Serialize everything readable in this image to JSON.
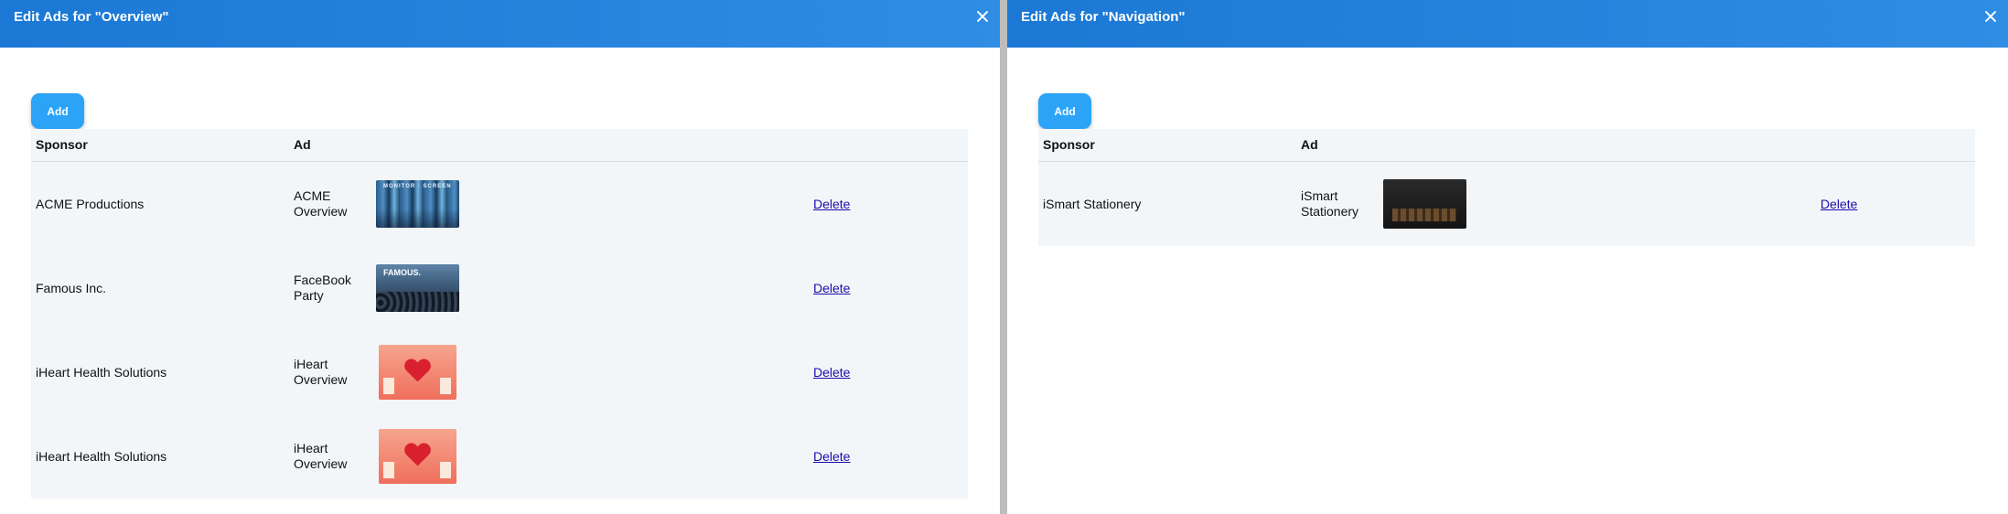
{
  "panels": [
    {
      "title": "Edit Ads for \"Overview\"",
      "add_label": "Add",
      "columns": {
        "sponsor": "Sponsor",
        "ad": "Ad"
      },
      "rows": [
        {
          "sponsor": "ACME Productions",
          "ad": "ACME Overview",
          "thumbnail": "acme-overview-thumbnail",
          "delete_label": "Delete"
        },
        {
          "sponsor": "Famous Inc.",
          "ad": "FaceBook Party",
          "thumbnail": "famous-facebook-party-thumbnail",
          "delete_label": "Delete"
        },
        {
          "sponsor": "iHeart Health Solutions",
          "ad": "iHeart Overview",
          "thumbnail": "iheart-overview-thumbnail",
          "delete_label": "Delete"
        },
        {
          "sponsor": "iHeart Health Solutions",
          "ad": "iHeart Overview",
          "thumbnail": "iheart-overview-thumbnail",
          "delete_label": "Delete"
        }
      ]
    },
    {
      "title": "Edit Ads for \"Navigation\"",
      "add_label": "Add",
      "columns": {
        "sponsor": "Sponsor",
        "ad": "Ad"
      },
      "rows": [
        {
          "sponsor": "iSmart Stationery",
          "ad": "iSmart Stationery",
          "thumbnail": "ismart-stationery-thumbnail",
          "delete_label": "Delete"
        }
      ]
    }
  ],
  "colors": {
    "header": "#2f8de4",
    "add_button": "#2ba4f8",
    "table_background": "#f3f6f9",
    "link": "#1a0dab",
    "divider": "#bdbdbd"
  },
  "icons": {
    "close": "close-icon"
  }
}
